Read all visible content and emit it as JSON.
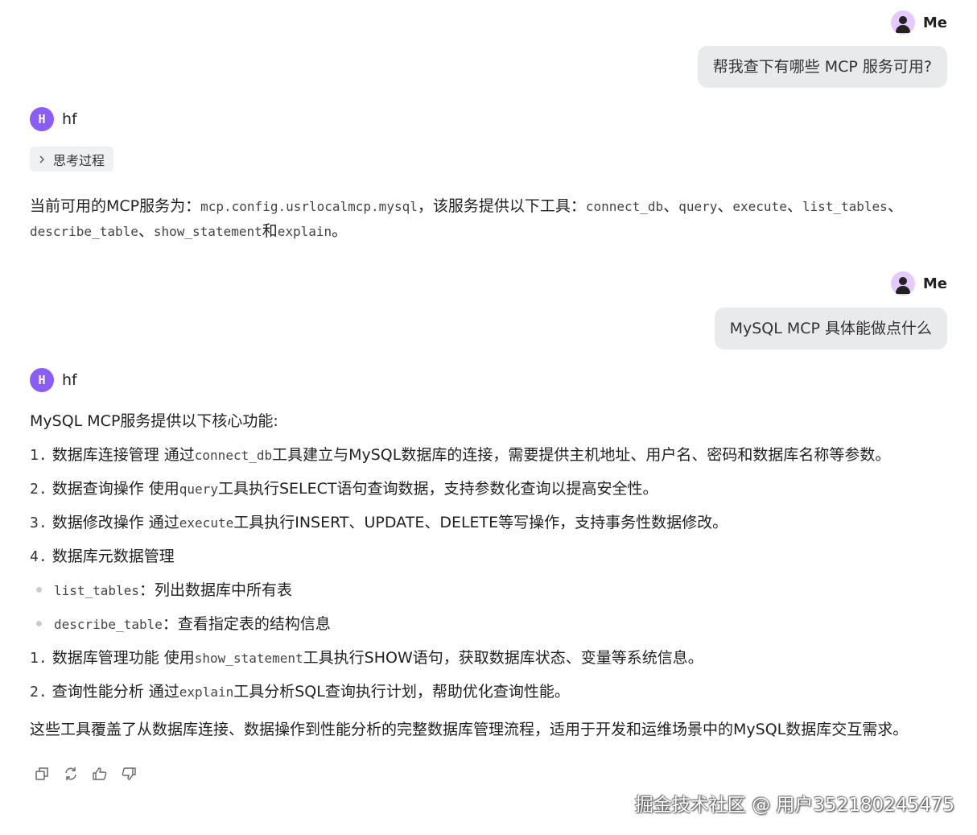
{
  "messages": [
    {
      "sender": "Me",
      "text": "帮我查下有哪些 MCP 服务可用?"
    },
    {
      "sender": "hf",
      "avatar_letter": "H",
      "thinking_label": "思考过程",
      "parts": [
        "当前可用的MCP服务为：",
        "mcp.config.usrlocalmcp.mysql",
        "，该服务提供以下工具：",
        "connect_db",
        "、",
        "query",
        "、",
        "execute",
        "、",
        "list_tables",
        "、",
        "describe_table",
        "、",
        "show_statement",
        "和",
        "explain",
        "。"
      ]
    },
    {
      "sender": "Me",
      "text": "MySQL MCP 具体能做点什么"
    },
    {
      "sender": "hf",
      "avatar_letter": "H",
      "intro": "MySQL MCP服务提供以下核心功能:",
      "items": [
        {
          "num": "1.",
          "a": "数据库连接管理 通过",
          "code": "connect_db",
          "b": "工具建立与MySQL数据库的连接，需要提供主机地址、用户名、密码和数据库名称等参数。"
        },
        {
          "num": "2.",
          "a": "数据查询操作 使用",
          "code": "query",
          "b": "工具执行SELECT语句查询数据，支持参数化查询以提高安全性。"
        },
        {
          "num": "3.",
          "a": "数据修改操作 通过",
          "code": "execute",
          "b": "工具执行INSERT、UPDATE、DELETE等写操作，支持事务性数据修改。"
        },
        {
          "num": "4.",
          "a": "数据库元数据管理"
        }
      ],
      "bullets": [
        {
          "code": "list_tables",
          "b": "：列出数据库中所有表"
        },
        {
          "code": "describe_table",
          "b": "：查看指定表的结构信息"
        }
      ],
      "items2": [
        {
          "num": "1.",
          "a": "数据库管理功能 使用",
          "code": "show_statement",
          "b": "工具执行SHOW语句，获取数据库状态、变量等系统信息。"
        },
        {
          "num": "2.",
          "a": "查询性能分析 通过",
          "code": "explain",
          "b": "工具分析SQL查询执行计划，帮助优化查询性能。"
        }
      ],
      "outro": "这些工具覆盖了从数据库连接、数据操作到性能分析的完整数据库管理流程，适用于开发和运维场景中的MySQL数据库交互需求。"
    }
  ],
  "watermark": "掘金技术社区 @ 用户352180245475"
}
